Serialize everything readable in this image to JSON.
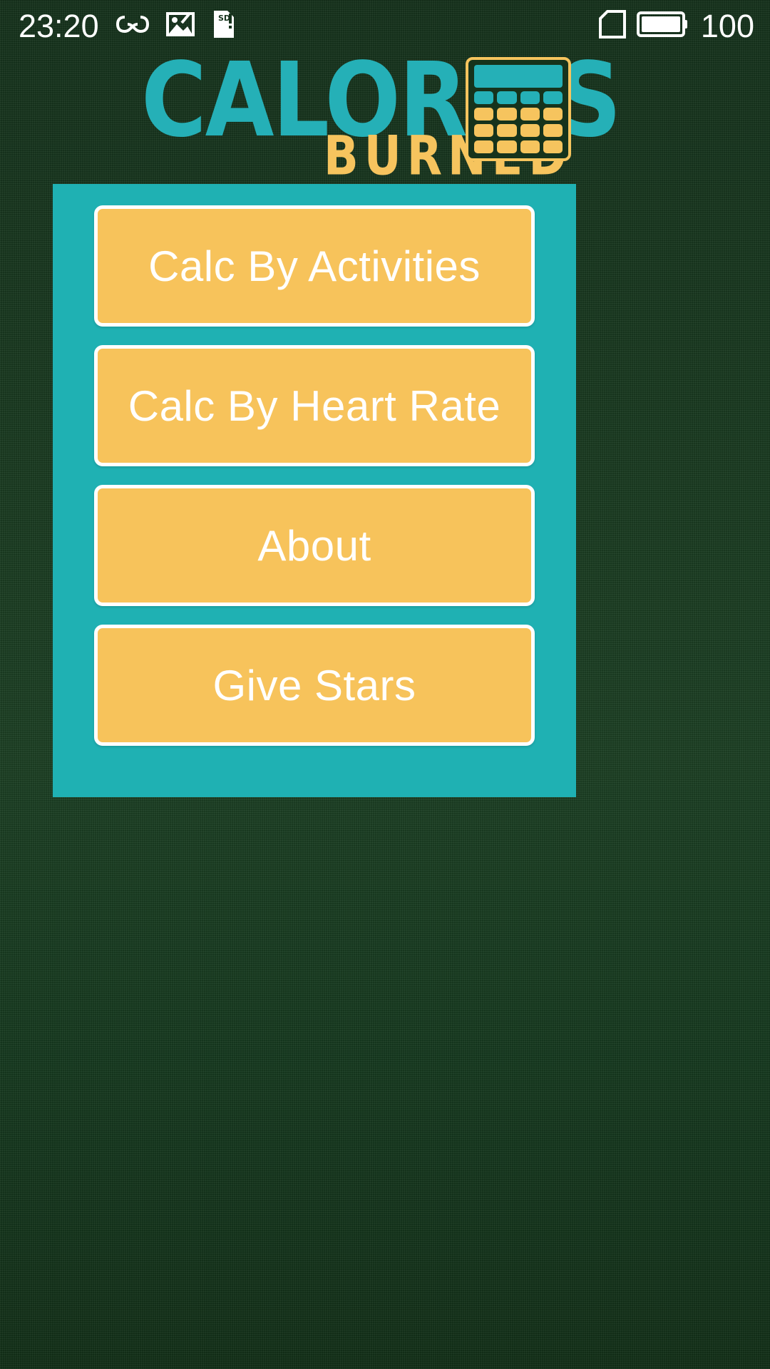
{
  "status_bar": {
    "time": "23:20",
    "battery_percent": "100",
    "icons": [
      {
        "name": "infinity-icon",
        "label": "∞"
      },
      {
        "name": "photo-edit-icon",
        "label": "photo"
      },
      {
        "name": "sd-card-warning-icon",
        "label": "SD !"
      },
      {
        "name": "sim-card-icon",
        "label": "sim"
      },
      {
        "name": "battery-full-icon",
        "label": "battery"
      }
    ]
  },
  "logo": {
    "primary_text": "CALORIES",
    "secondary_text": "BURNED",
    "primary_color": "#25b0b7",
    "secondary_color": "#f6c45e",
    "calculator_icon": "calculator-icon"
  },
  "menu": {
    "card_color": "#1fb1b3",
    "button_color": "#f7c35b",
    "button_text_color": "#ffffff",
    "buttons": [
      {
        "id": "calc-by-activities",
        "label": "Calc By Activities"
      },
      {
        "id": "calc-by-heart-rate",
        "label": "Calc By Heart Rate"
      },
      {
        "id": "about",
        "label": "About"
      },
      {
        "id": "give-stars",
        "label": "Give Stars"
      }
    ]
  },
  "background": {
    "color": "#16331c"
  }
}
